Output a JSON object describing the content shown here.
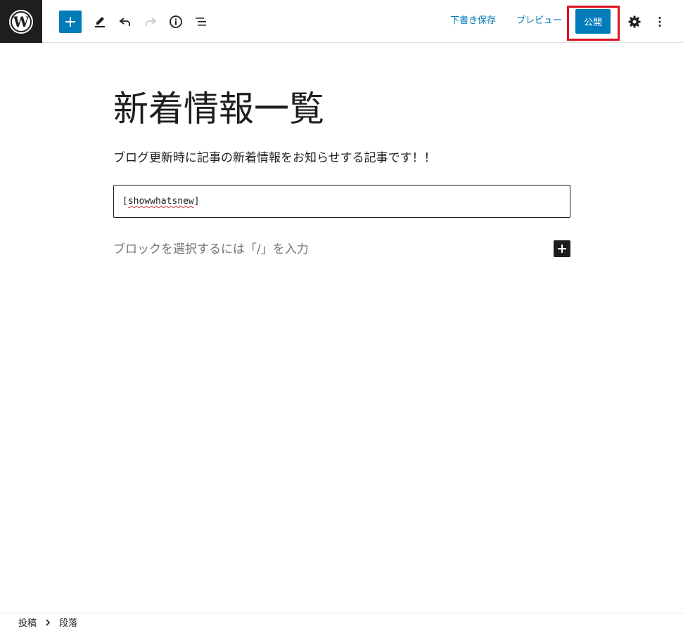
{
  "header": {
    "logo_icon": "wordpress-logo-icon",
    "toolbar_icons": [
      "plus-icon",
      "pencil-icon",
      "undo-icon",
      "redo-icon",
      "info-icon",
      "list-view-icon",
      "gear-icon",
      "more-vertical-icon"
    ],
    "save_draft_label": "下書き保存",
    "preview_label": "プレビュー",
    "publish_label": "公開"
  },
  "editor": {
    "title": "新着情報一覧",
    "paragraph": "ブログ更新時に記事の新着情報をお知らせする記事です！！",
    "shortcode_open": "[",
    "shortcode_text": "showwhatsnew",
    "shortcode_close": "]",
    "placeholder": "ブロックを選択するには「/」を入力"
  },
  "footer": {
    "breadcrumb": [
      "投稿",
      "段落"
    ]
  },
  "colors": {
    "accent": "#007cba",
    "highlight": "#e0101e",
    "dark": "#1e1e1e"
  }
}
